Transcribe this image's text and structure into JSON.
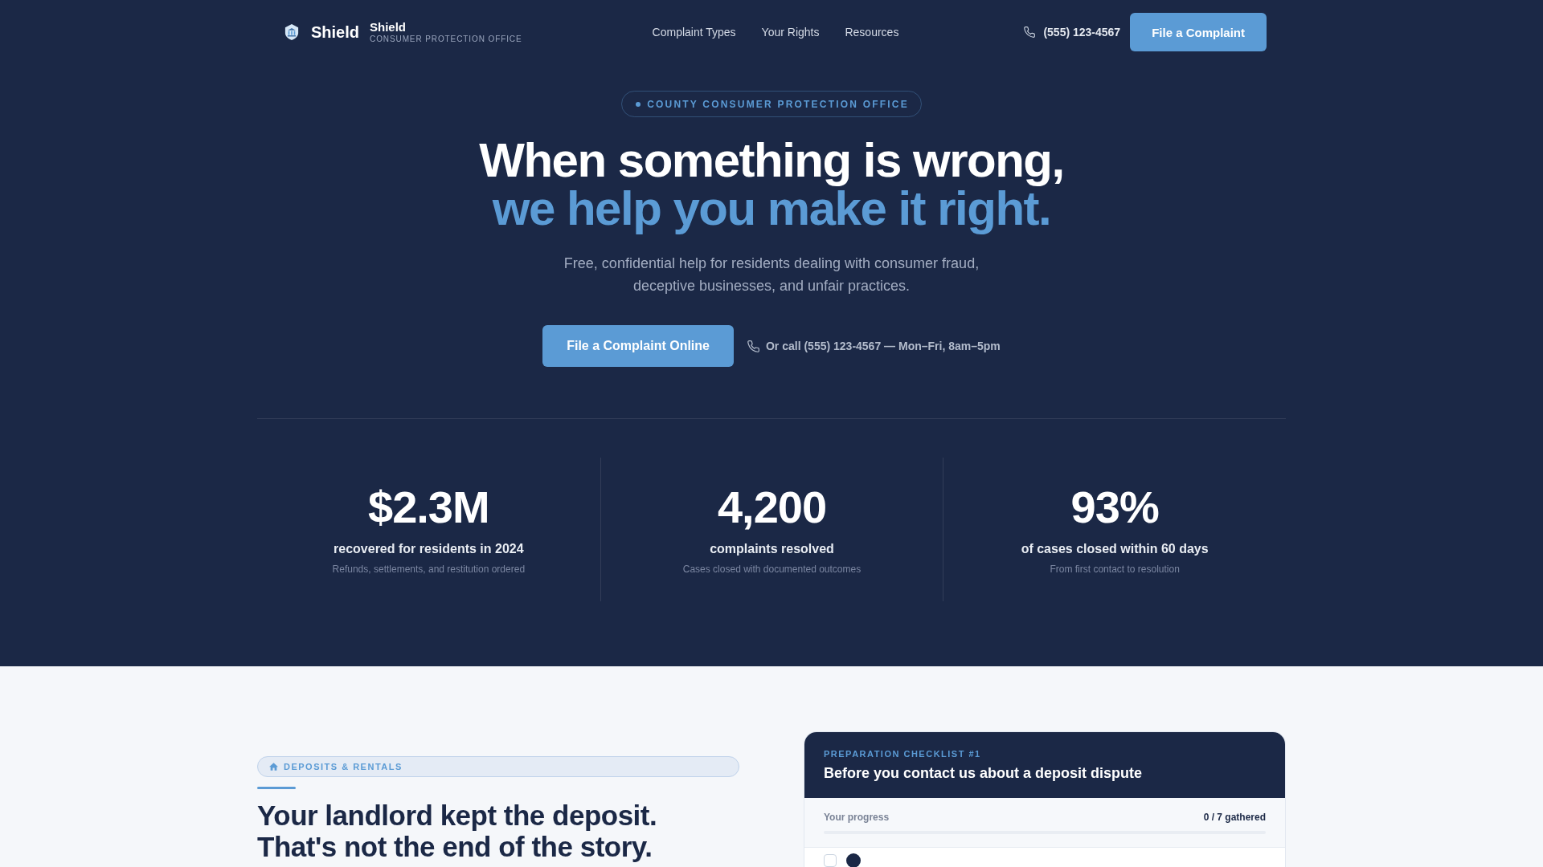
{
  "header": {
    "brand": {
      "wordmark": "Shield",
      "name": "Shield",
      "tagline": "CONSUMER PROTECTION OFFICE"
    },
    "nav": [
      {
        "label": "Complaint Types"
      },
      {
        "label": "Your Rights"
      },
      {
        "label": "Resources"
      }
    ],
    "phone": "(555) 123-4567",
    "cta": "File a Complaint"
  },
  "hero": {
    "eyebrow": "COUNTY CONSUMER PROTECTION OFFICE",
    "title": "When something is wrong,",
    "title_accent": "we help you make it right.",
    "lead": "Free, confidential help for residents dealing with consumer fraud, deceptive businesses, and unfair practices.",
    "cta": "File a Complaint Online",
    "call_note": "Or call (555) 123-4567 — Mon–Fri, 8am–5pm"
  },
  "stats": [
    {
      "value": "$2.3M",
      "label": "recovered for residents in 2024",
      "note": "Refunds, settlements, and restitution ordered"
    },
    {
      "value": "4,200",
      "label": "complaints resolved",
      "note": "Cases closed with documented outcomes"
    },
    {
      "value": "93%",
      "label": "of cases closed within 60 days",
      "note": "From first contact to resolution"
    }
  ],
  "topic": {
    "tag": "DEPOSITS & RENTALS",
    "heading": "Your landlord kept the deposit. That's not the end of the story."
  },
  "checklist": {
    "eyebrow": "PREPARATION CHECKLIST #1",
    "title": "Before you contact us about a deposit dispute",
    "progress_label": "Your progress",
    "progress_count": "0 / 7 gathered",
    "level": 0,
    "items": [
      {
        "checked": false
      }
    ]
  }
}
